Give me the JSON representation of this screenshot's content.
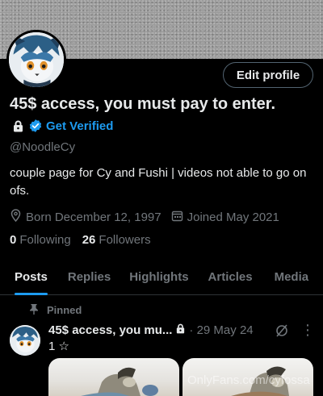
{
  "profile": {
    "edit_label": "Edit profile",
    "display_name": "45$ access, you must pay to enter.",
    "get_verified": "Get Verified",
    "handle": "@NoodleCy",
    "bio": "couple page for Cy and Fushi | videos not able to go on ofs.",
    "born": "Born December 12, 1997",
    "joined": "Joined May 2021",
    "following_count": "0",
    "following_label": "Following",
    "followers_count": "26",
    "followers_label": "Followers",
    "accent_color": "#1d9bf0"
  },
  "tabs": [
    {
      "label": "Posts",
      "active": true
    },
    {
      "label": "Replies"
    },
    {
      "label": "Highlights"
    },
    {
      "label": "Articles"
    },
    {
      "label": "Media"
    }
  ],
  "post": {
    "pinned_label": "Pinned",
    "name": "45$ access, you mu...",
    "date": "· 29 May 24",
    "text": "1 ☆",
    "watermark": "OnlyFans.com/cyfossa"
  },
  "icons": [
    "lock-icon",
    "verified-badge-icon",
    "location-icon",
    "calendar-icon",
    "pin-icon",
    "grok-icon",
    "more-icon"
  ]
}
